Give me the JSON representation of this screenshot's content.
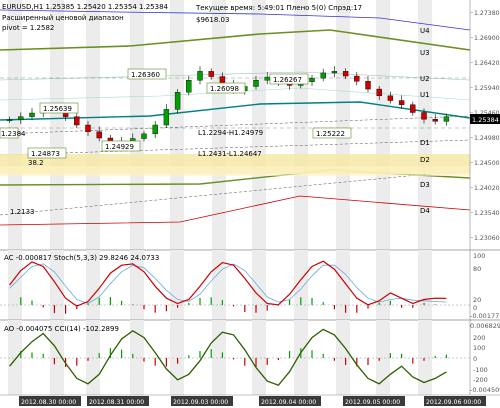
{
  "chart_data": [
    {
      "type": "candlestick",
      "symbol_line": "EURUSD,H1  1.25385 1.25420 1.25354 1.25384",
      "info_left_1": "Расширенный ценовой диапазон",
      "info_left_2": "pivot = 1.2582",
      "info_right_1": "Текущее время: 5:49:01 Плено 5(0) Спрэд:17",
      "info_right_2": "$9618.03",
      "current_price": "1.25384",
      "price_ticks": [
        "1.27380",
        "1.26900",
        "1.26420",
        "1.25940",
        "1.25460",
        "1.24980",
        "1.24500",
        "1.24020",
        "1.23540",
        "1.23060"
      ],
      "ylim": [
        1.2282,
        1.2762
      ],
      "level_labels": [
        "U4",
        "U3",
        "U2",
        "U1",
        "D1",
        "D2",
        "D3",
        "D4"
      ],
      "price_tags": [
        "1.26360",
        "1.26267",
        "1.26098",
        "1.25639",
        "1.24873",
        "1.24929",
        "1.25222",
        "1.2384"
      ],
      "trend_labels": [
        "L1.2294-H1.24979",
        "L1.2431-L1.24647",
        "1.2133",
        "38.2"
      ],
      "close_series": [
        1.2532,
        1.2538,
        1.2545,
        1.2556,
        1.2551,
        1.2538,
        1.2522,
        1.2509,
        1.2497,
        1.2488,
        1.2491,
        1.2496,
        1.2505,
        1.2522,
        1.2552,
        1.2585,
        1.2608,
        1.2625,
        1.2615,
        1.2599,
        1.2588,
        1.2596,
        1.2608,
        1.2614,
        1.2603,
        1.2598,
        1.2605,
        1.2612,
        1.2622,
        1.2625,
        1.2616,
        1.2606,
        1.2591,
        1.2578,
        1.2569,
        1.2561,
        1.2546,
        1.2533,
        1.2529,
        1.2538
      ]
    },
    {
      "type": "oscillator",
      "label": "AC -0.000817  Stoch(5,3,3) 29.8246 24.0733",
      "ticks": [
        "100",
        "80",
        "20",
        "0"
      ],
      "extra_tick": "-0.00177",
      "series": [
        {
          "name": "Stoch",
          "values": [
            50,
            72,
            85,
            78,
            55,
            30,
            18,
            25,
            45,
            68,
            80,
            82,
            70,
            48,
            30,
            22,
            28,
            48,
            70,
            84,
            80,
            60,
            38,
            22,
            20,
            36,
            58,
            78,
            86,
            74,
            52,
            30,
            20,
            26,
            38,
            30,
            22,
            28,
            30,
            29.8
          ]
        },
        {
          "name": "Signal",
          "values": [
            45,
            62,
            78,
            82,
            70,
            48,
            28,
            22,
            32,
            52,
            70,
            80,
            76,
            60,
            42,
            28,
            25,
            36,
            56,
            74,
            82,
            72,
            52,
            32,
            24,
            28,
            44,
            64,
            80,
            80,
            66,
            46,
            30,
            24,
            28,
            30,
            27,
            26,
            25,
            24.1
          ]
        }
      ]
    },
    {
      "type": "oscillator",
      "label": "AO -0.004075  CCI(14) -102.2899",
      "ticks": [
        "200",
        "100",
        "0",
        "-100",
        "-200"
      ],
      "extra_tick": "0.006829",
      "lower_tick": "-0.004509",
      "series": [
        {
          "name": "CCI",
          "values": [
            -60,
            40,
            120,
            180,
            90,
            -40,
            -150,
            -190,
            -120,
            20,
            140,
            200,
            150,
            40,
            -80,
            -160,
            -120,
            -20,
            110,
            190,
            170,
            60,
            -70,
            -170,
            -200,
            -100,
            40,
            150,
            210,
            170,
            70,
            -50,
            -150,
            -190,
            -120,
            -60,
            -140,
            -180,
            -150,
            -102
          ]
        }
      ]
    }
  ],
  "time_ticks": [
    "2012.08.30 00:00",
    "2012.08.31 00:00",
    "2012.09.03 00:00",
    "2012.09.04 00:00",
    "2012.09.05 00:00",
    "2012.09.06 00:00"
  ],
  "colors": {
    "candle": "#000000",
    "bull_candle": "#00a000",
    "bear_candle": "#cc0000",
    "teal": "#008080",
    "olive": "#6b8e23",
    "blue_channel": "#3333cc",
    "red_channel": "#cc0000",
    "yellow_zone": "#f7e9a8",
    "stoch": "#cc0000",
    "stoch_signal": "#333333",
    "cci": "#2e5e00"
  }
}
